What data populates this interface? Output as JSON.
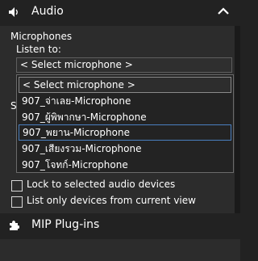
{
  "audio_section": {
    "title": "Audio",
    "icon": "speaker-icon",
    "collapse_icon": "chevron-up-icon"
  },
  "microphones": {
    "heading": "Microphones",
    "listen_to_label": "Listen to:",
    "selected_value": "< Select microphone >",
    "options": [
      "< Select microphone >",
      "907_จ่าเลย-Microphone",
      "907_ผู้พิพากษา-Microphone",
      "907_พยาน-Microphone",
      "907_เสียงรวม-Microphone",
      "907_โจทก์-Microphone"
    ],
    "partial_label": "S"
  },
  "options": {
    "lock_label": "Lock to selected audio devices",
    "list_only_label": "List only devices from current view"
  },
  "mip_section": {
    "title": "MIP Plug-ins",
    "icon": "puzzle-icon"
  }
}
